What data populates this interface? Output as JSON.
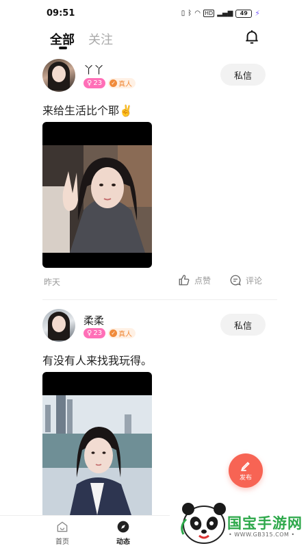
{
  "status": {
    "time": "09:51",
    "battery": "49"
  },
  "tabs": [
    {
      "label": "全部"
    },
    {
      "label": "关注"
    }
  ],
  "posts": [
    {
      "username": "丫丫",
      "age": "23",
      "verified": "真人",
      "message_label": "私信",
      "text": "来给生活比个耶✌️",
      "time": "昨天",
      "like_label": "点赞",
      "comment_label": "评论"
    },
    {
      "username": "柔柔",
      "age": "23",
      "verified": "真人",
      "message_label": "私信",
      "text": "有没有人来找我玩得。"
    }
  ],
  "fab": {
    "label": "发布",
    "color": "#f76454"
  },
  "nav": [
    {
      "label": "首页"
    },
    {
      "label": "动态"
    }
  ],
  "watermark": {
    "brand": "国宝手游网",
    "url": "• WWW.GB315.COM •"
  },
  "colors": {
    "accent_pink": "#ff6fb7",
    "verified_orange": "#f08a3a"
  }
}
